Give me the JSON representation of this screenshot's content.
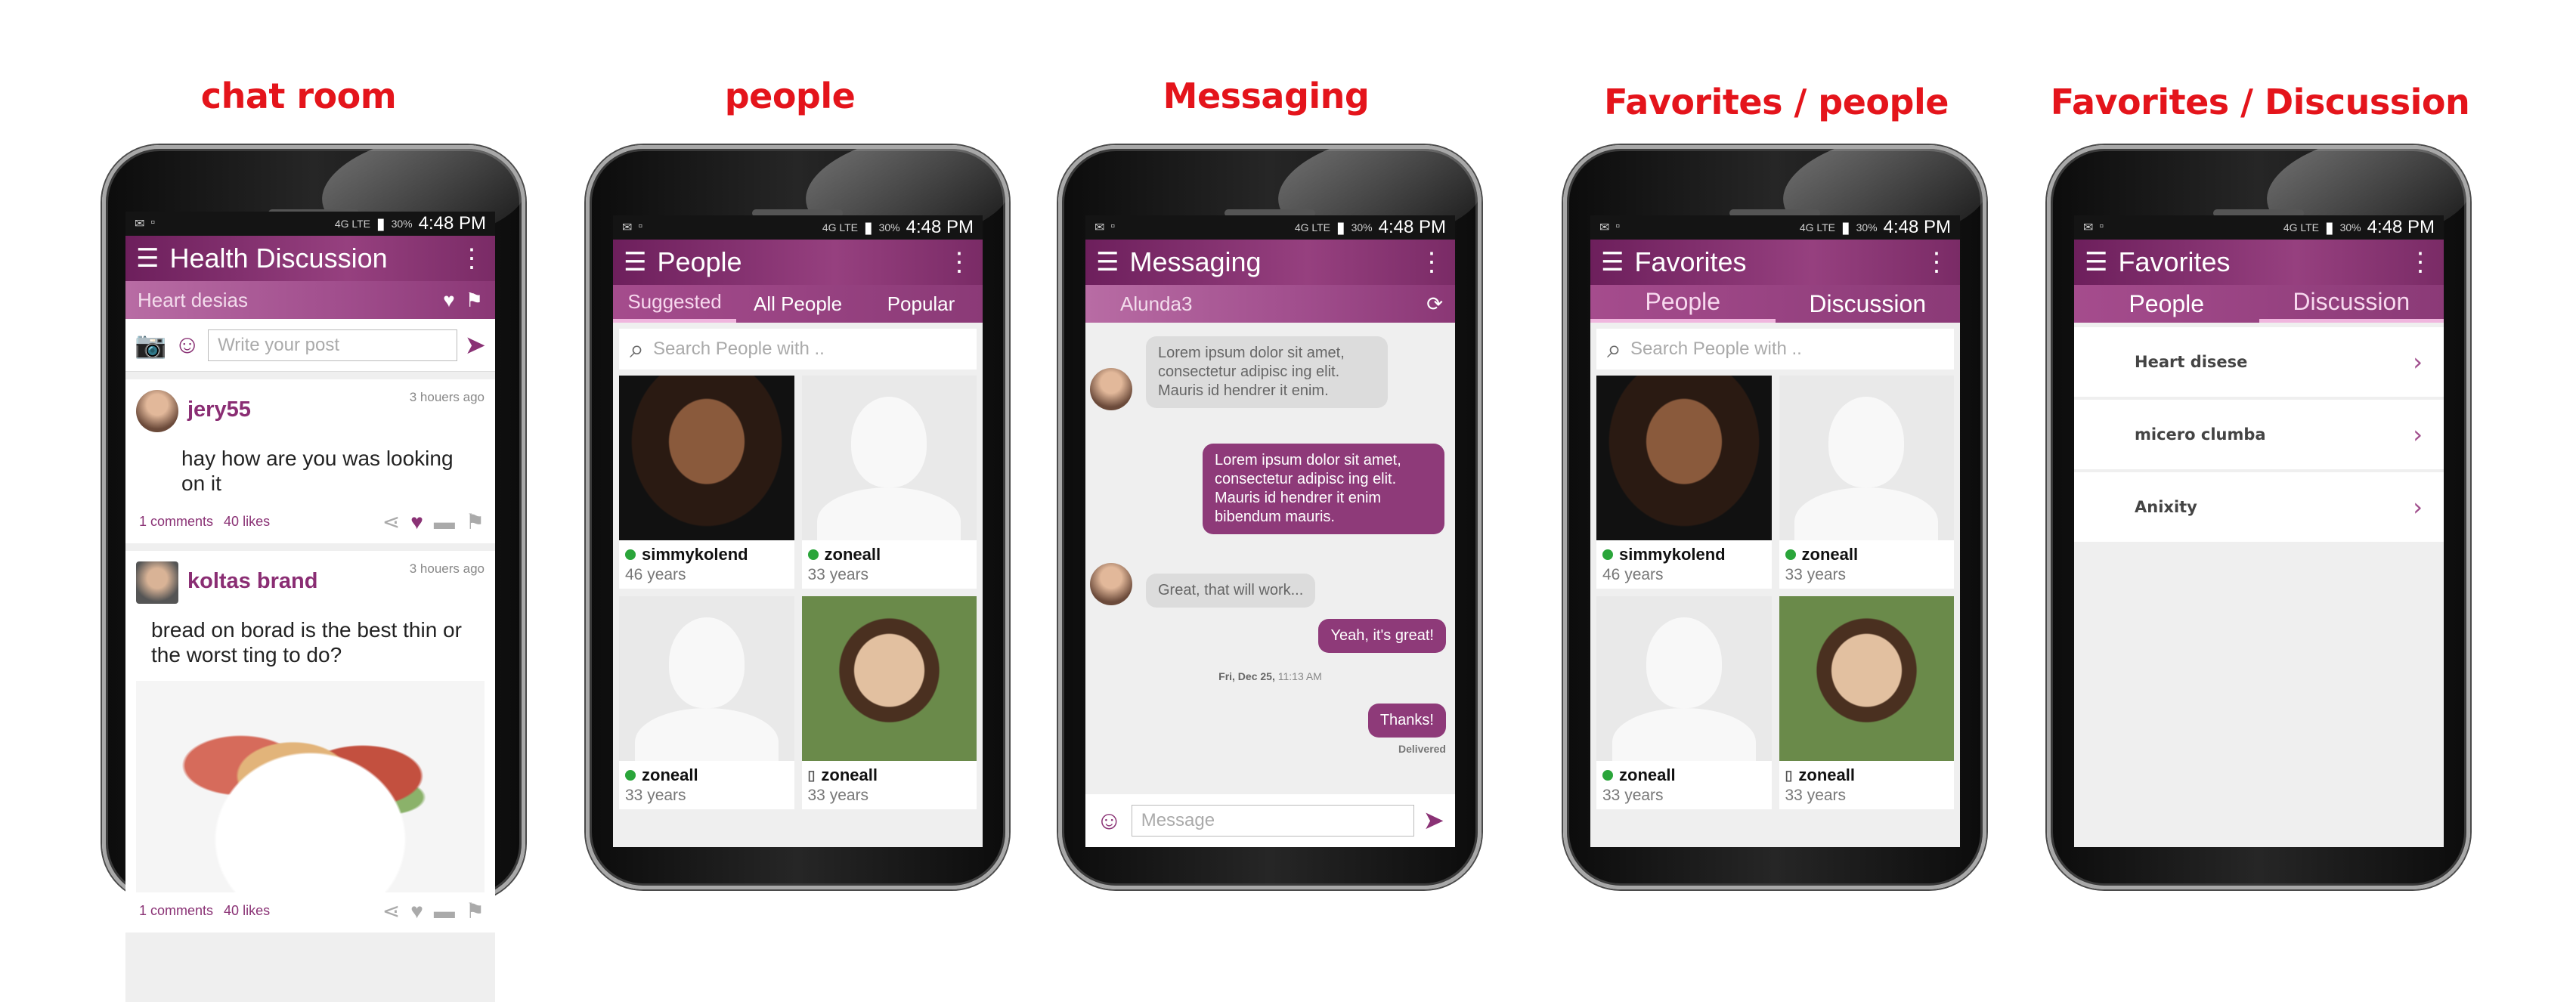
{
  "headings": [
    "chat room",
    "people",
    "Messaging",
    "Favorites / people",
    "Favorites / Discussion"
  ],
  "status_bar": {
    "network": "4G LTE",
    "battery": "30%",
    "time": "4:48 PM"
  },
  "accent_color": "#8a3275",
  "chat_room": {
    "title": "Health Discussion",
    "subtitle": "Heart desias",
    "post_placeholder": "Write your post",
    "posts": [
      {
        "user": "jery55",
        "ago": "3 houers ago",
        "text": "hay how are you was looking on it",
        "comments": "1 comments",
        "likes": "40 likes"
      },
      {
        "user": "koltas brand",
        "ago": "3 houers ago",
        "text": "bread on borad is the best thin or the worst ting to do?",
        "comments": "1 comments",
        "likes": "40 likes"
      }
    ]
  },
  "people": {
    "title": "People",
    "tabs": [
      "Suggested",
      "All People",
      "Popular"
    ],
    "search_placeholder": "Search People with ..",
    "cards": [
      {
        "name": "simmykolend",
        "age": "46 years"
      },
      {
        "name": "zoneall",
        "age": "33 years"
      },
      {
        "name": "zoneall",
        "age": "33 years"
      },
      {
        "name": "zoneall",
        "age": "33 years"
      }
    ]
  },
  "messaging": {
    "title": "Messaging",
    "contact": "Alunda3",
    "messages": [
      {
        "text": "Lorem ipsum dolor sit amet, consectetur adipisc ing elit. Mauris id hendrer it enim."
      },
      {
        "text": "Lorem ipsum dolor sit amet, consectetur adipisc ing elit. Mauris id hendrer it enim bibendum mauris."
      },
      {
        "text": "Great, that will work..."
      },
      {
        "text": "Yeah, it's great!"
      },
      {
        "text": "Thanks!"
      }
    ],
    "date_day": "Fri, Dec 25,",
    "date_time": "11:13 AM",
    "delivered": "Delivered",
    "composer_placeholder": "Message"
  },
  "favorites": {
    "title": "Favorites",
    "tabs": [
      "People",
      "Discussion"
    ],
    "search_placeholder": "Search People with ..",
    "cards": [
      {
        "name": "simmykolend",
        "age": "46 years"
      },
      {
        "name": "zoneall",
        "age": "33 years"
      },
      {
        "name": "zoneall",
        "age": "33 years"
      },
      {
        "name": "zoneall",
        "age": "33 years"
      }
    ],
    "discussions": [
      "Heart disese",
      "micero clumba",
      "Anixity"
    ]
  }
}
